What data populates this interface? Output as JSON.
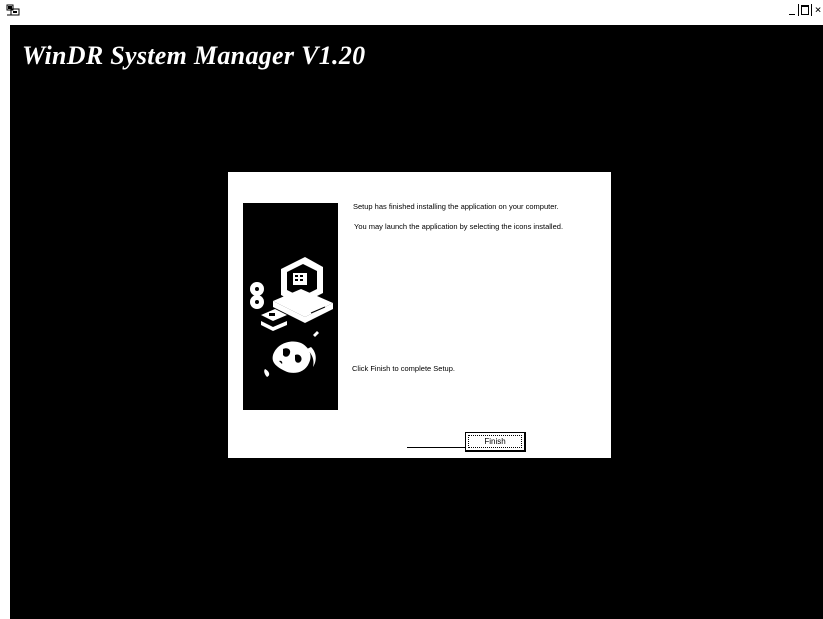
{
  "window": {
    "minimize_icon": "minimize-icon",
    "maximize_icon": "maximize-icon",
    "close_icon": "close-icon",
    "close_glyph": "×",
    "app_icon": "setup-icon"
  },
  "app_title": "WinDR System Manager V1.20",
  "dialog": {
    "message_finished": "Setup has finished installing the application on your computer.",
    "message_launch": "You may launch the application by selecting the icons installed.",
    "message_click_finish": "Click Finish to complete Setup.",
    "finish_label": "Finish",
    "illustration": "computer-disks-globe-illustration"
  },
  "colors": {
    "background": "#000000",
    "dialog": "#ffffff",
    "title_text": "#ffffff"
  }
}
